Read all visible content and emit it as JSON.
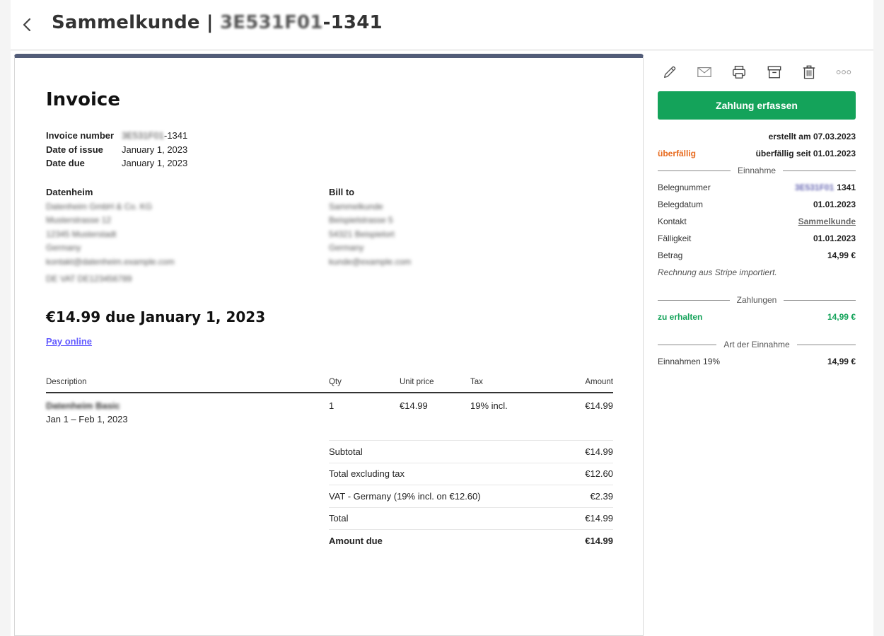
{
  "header": {
    "title_prefix": "Sammelkunde | ",
    "title_id_blurred": "3E531F01",
    "title_suffix": "-1341"
  },
  "invoice": {
    "title": "Invoice",
    "meta": [
      {
        "label": "Invoice number",
        "value_blurred": "3E531F01",
        "value": "-1341"
      },
      {
        "label": "Date of issue",
        "value": "January 1, 2023"
      },
      {
        "label": "Date due",
        "value": "January 1, 2023"
      }
    ],
    "from": {
      "heading": "Datenheim",
      "lines": [
        "Datenheim GmbH & Co. KG",
        "Musterstrasse 12",
        "12345 Musterstadt",
        "Germany",
        "kontakt@datenheim.example.com",
        "DE VAT DE123456789"
      ]
    },
    "bill_to": {
      "heading": "Bill to",
      "lines": [
        "Sammelkunde",
        "Beispielstrasse 5",
        "54321 Beispielort",
        "Germany",
        "kunde@example.com"
      ]
    },
    "amount_due_headline": "€14.99 due January 1, 2023",
    "pay_link": "Pay online",
    "columns": {
      "description": "Description",
      "qty": "Qty",
      "unit_price": "Unit price",
      "tax": "Tax",
      "amount": "Amount"
    },
    "items": [
      {
        "description": "Datenheim Basic",
        "period": "Jan 1 – Feb 1, 2023",
        "qty": "1",
        "unit_price": "€14.99",
        "tax": "19% incl.",
        "amount": "€14.99"
      }
    ],
    "totals": [
      {
        "label": "Subtotal",
        "value": "€14.99",
        "bold": false
      },
      {
        "label": "Total excluding tax",
        "value": "€12.60",
        "bold": false
      },
      {
        "label": "VAT - Germany (19% incl. on €12.60)",
        "value": "€2.39",
        "bold": false
      },
      {
        "label": "Total",
        "value": "€14.99",
        "bold": false
      },
      {
        "label": "Amount due",
        "value": "€14.99",
        "bold": true
      }
    ]
  },
  "toolbar": {
    "icons": [
      "pencil-icon",
      "mail-icon",
      "printer-icon",
      "archive-icon",
      "trash-icon",
      "more-icon"
    ],
    "primary_button": "Zahlung erfassen"
  },
  "sidebar": {
    "created": "erstellt am 07.03.2023",
    "status_label": "überfällig",
    "status_since": "überfällig seit 01.01.2023",
    "section_income": "Einnahme",
    "rows": [
      {
        "label": "Belegnummer",
        "value_blurred": "3E531F01",
        "value": "1341"
      },
      {
        "label": "Belegdatum",
        "value": "01.01.2023"
      },
      {
        "label": "Kontakt",
        "value": "Sammelkunde"
      },
      {
        "label": "Fälligkeit",
        "value": "01.01.2023"
      },
      {
        "label": "Betrag",
        "value": "14,99 €"
      }
    ],
    "note": "Rechnung aus Stripe importiert.",
    "section_payments": "Zahlungen",
    "to_receive_label": "zu erhalten",
    "to_receive_value": "14,99 €",
    "section_type": "Art der Einnahme",
    "type_label": "Einnahmen 19%",
    "type_value": "14,99 €"
  },
  "colors": {
    "primary_green": "#14a35a",
    "overdue_orange": "#e86b1f",
    "doc_topbar": "#525c78",
    "stripe_link": "#635bff"
  }
}
